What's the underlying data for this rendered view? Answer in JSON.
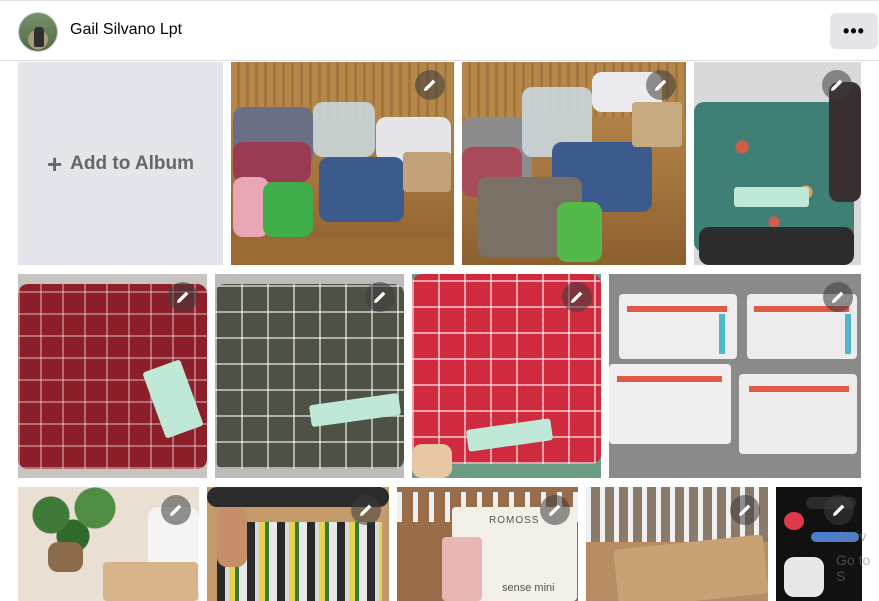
{
  "header": {
    "username": "Gail Silvano Lpt",
    "more_label": "•••"
  },
  "album": {
    "add_label": "Add to Album",
    "add_icon": "+"
  },
  "photos": {
    "boxed_text": "ROMOSS",
    "boxed_sub": "sense mini"
  },
  "overlay": {
    "line1": "Activ",
    "line2": "Go to S"
  },
  "icons": {
    "edit": "pencil-icon",
    "more": "ellipsis-icon"
  },
  "colors": {
    "tile_bg": "#e4e6eb",
    "label": "#65676b",
    "edit_bg": "rgba(60,60,60,0.55)"
  }
}
